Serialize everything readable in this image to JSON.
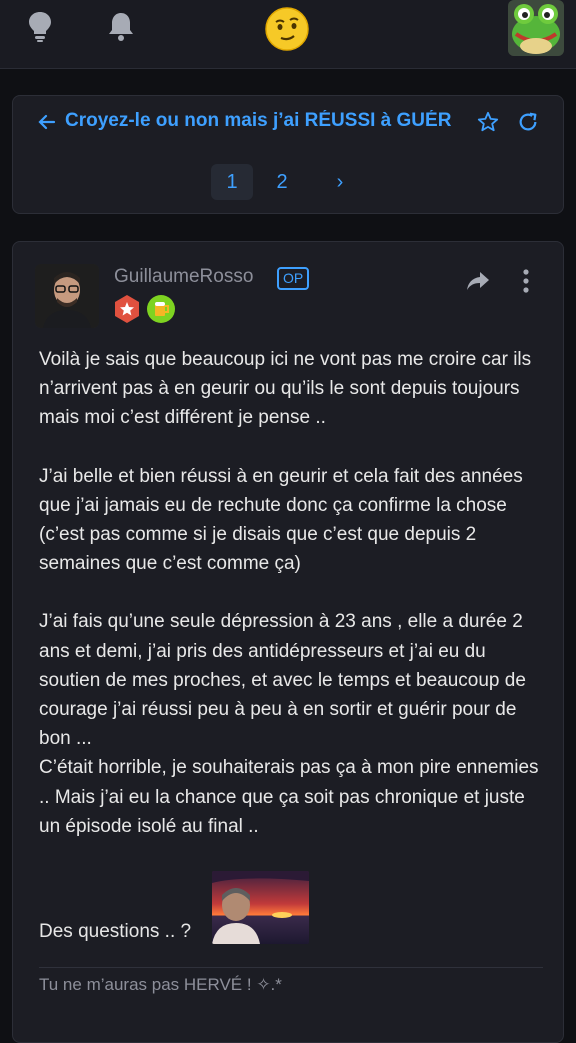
{
  "topbar": {
    "icons": [
      "lightbulb-icon",
      "bell-icon",
      "smiley-logo-icon",
      "frog-avatar"
    ]
  },
  "topic": {
    "title": "Croyez-le ou non mais j’ai RÉUSSI à GUÉR",
    "pages": [
      "1",
      "2"
    ],
    "next": "›",
    "current_page": "1"
  },
  "post": {
    "username": "GuillaumeRosso",
    "op_badge": "OP",
    "paragraphs": [
      "Voilà je sais que beaucoup ici ne vont pas me croire car ils n’arrivent pas à en geurir ou qu’ils le sont depuis toujours mais moi c’est différent je pense ..",
      "J’ai belle et bien réussi à en geurir et cela fait des années que j’ai jamais eu de rechute donc ça confirme la chose (c’est pas comme si je disais que c’est que depuis 2 semaines que c’est comme ça)",
      "J’ai fais qu’une seule dépression à 23 ans , elle a durée 2 ans et demi, j’ai pris des antidépresseurs et j’ai eu du soutien de mes proches, et avec le temps et beaucoup de courage j’ai réussi peu à peu à en sortir et guérir pour de bon ...",
      "C’était horrible, je souhaiterais pas ça à mon pire ennemies .. Mais j’ai eu la chance que ça soit pas chronique et juste un épisode isolé au final .."
    ],
    "questions": "Des questions .. ?",
    "signature": "Tu ne m’auras pas HERVÉ ! ✧.*"
  },
  "colors": {
    "background": "#0f1014",
    "card": "#1c1d24",
    "accent": "#3ea0ff",
    "muted": "#8d8f9a"
  }
}
